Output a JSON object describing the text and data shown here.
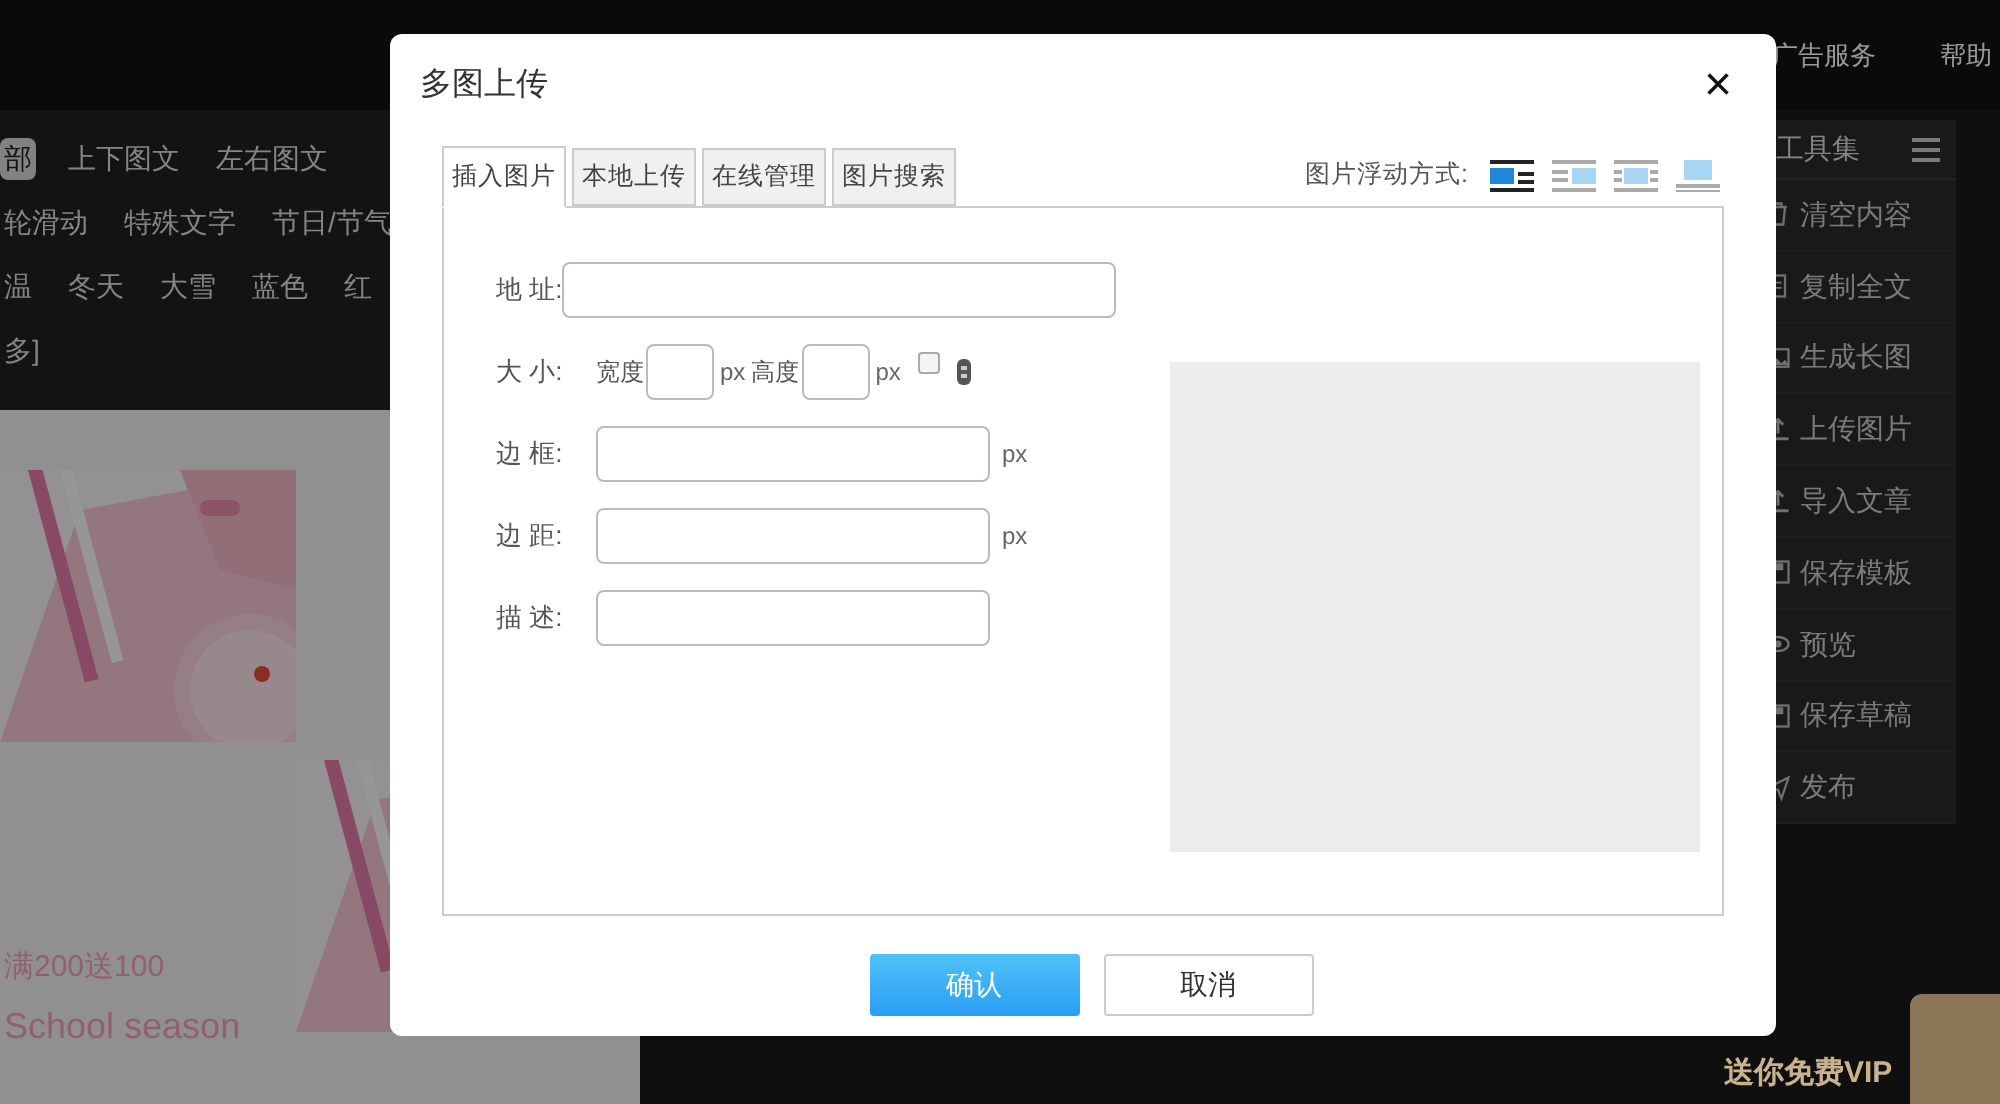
{
  "top_nav": [
    "广告服务",
    "帮助"
  ],
  "style_tags": [
    [
      {
        "label": "部",
        "selected": true
      },
      {
        "label": "上下图文",
        "selected": false
      },
      {
        "label": "左右图文",
        "selected": false
      }
    ],
    [
      {
        "label": "轮滑动",
        "selected": false
      },
      {
        "label": "特殊文字",
        "selected": false
      },
      {
        "label": "节日/节气",
        "selected": false
      }
    ],
    [
      {
        "label": "温",
        "selected": false
      },
      {
        "label": "冬天",
        "selected": false
      },
      {
        "label": "大雪",
        "selected": false
      },
      {
        "label": "蓝色",
        "selected": false
      },
      {
        "label": "红",
        "selected": false
      }
    ],
    [
      {
        "label": "多]",
        "selected": false
      }
    ]
  ],
  "template_texts": [
    "满200送100",
    "School season"
  ],
  "toolbox": {
    "title": "工具集",
    "items": [
      {
        "label": "清空内容"
      },
      {
        "label": "复制全文"
      },
      {
        "label": "生成长图"
      },
      {
        "label": "上传图片"
      },
      {
        "label": "导入文章"
      },
      {
        "label": "保存模板"
      },
      {
        "label": "预览"
      },
      {
        "label": "保存草稿"
      },
      {
        "label": "发布"
      }
    ]
  },
  "vip_badge": "送你免费VIP",
  "dialog": {
    "title": "多图上传",
    "close": "×",
    "tabs": [
      {
        "label": "插入图片",
        "selected": true
      },
      {
        "label": "本地上传",
        "selected": false
      },
      {
        "label": "在线管理",
        "selected": false
      },
      {
        "label": "图片搜索",
        "selected": false
      }
    ],
    "float_label": "图片浮动方式:",
    "float_modes": [
      {
        "selected": true
      },
      {
        "selected": false
      },
      {
        "selected": false
      },
      {
        "selected": false
      }
    ],
    "fields": [
      {
        "kind": "wide",
        "label": "地 址:"
      },
      {
        "kind": "size",
        "label": "大 小:",
        "width_label": "宽度",
        "width_unit": "px",
        "height_label": "高度",
        "height_unit": "px",
        "lock_checked": false
      },
      {
        "kind": "unit",
        "label": "边 框:",
        "unit": "px"
      },
      {
        "kind": "unit",
        "label": "边 距:",
        "unit": "px"
      },
      {
        "kind": "plain",
        "label": "描 述:"
      }
    ],
    "buttons": [
      {
        "label": "确认",
        "kind": "primary"
      },
      {
        "label": "取消",
        "kind": "secondary"
      }
    ]
  }
}
